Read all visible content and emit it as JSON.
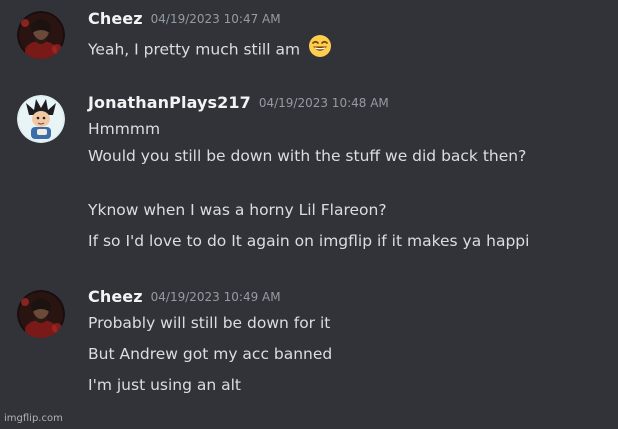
{
  "messages": [
    {
      "author": "Cheez",
      "timestamp": "04/19/2023 10:47 AM",
      "avatar_icon": "dark-figure-avatar",
      "lines": [
        {
          "text": "Yeah, I pretty much still am",
          "emoji": "grinning-face-with-smiling-eyes"
        }
      ]
    },
    {
      "author": "JonathanPlays217",
      "timestamp": "04/19/2023 10:48 AM",
      "avatar_icon": "anime-character-avatar",
      "lines": [
        {
          "text": "Hmmmm"
        },
        {
          "text": "Would you still be down with the stuff we did back then?"
        },
        {
          "text": ""
        },
        {
          "text": "Yknow when I was a horny Lil Flareon?"
        },
        {
          "text": "If so I'd love to do It again on imgflip if it makes ya happi"
        }
      ]
    },
    {
      "author": "Cheez",
      "timestamp": "04/19/2023 10:49 AM",
      "avatar_icon": "dark-figure-avatar",
      "lines": [
        {
          "text": "Probably will still be down for it"
        },
        {
          "text": "But Andrew got my acc banned"
        },
        {
          "text": "I'm just using an alt"
        }
      ]
    }
  ],
  "watermark": "imgflip.com",
  "colors": {
    "background": "#313338",
    "username": "#f2f3f5",
    "timestamp": "#949ba4",
    "message_text": "#dbdee1"
  }
}
